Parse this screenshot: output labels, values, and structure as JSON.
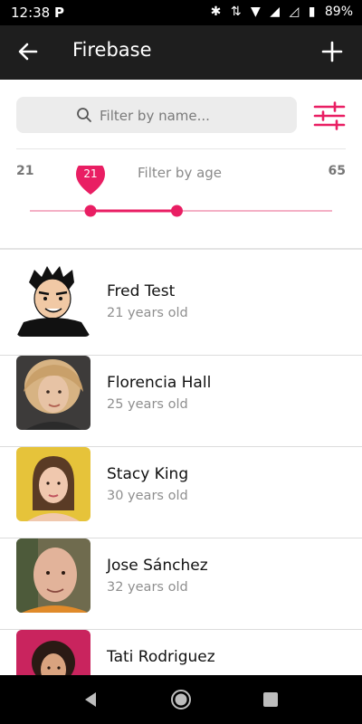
{
  "status_bar": {
    "time": "12:38",
    "battery": "89%"
  },
  "app_bar": {
    "title": "Firebase"
  },
  "search": {
    "placeholder": "Filter by name..."
  },
  "age_filter": {
    "label": "Filter by age",
    "min": "21",
    "max": "65",
    "bubble_value": "21",
    "range_low": 21,
    "range_high": 42
  },
  "colors": {
    "accent": "#e91e63",
    "appbar": "#1e1e1e"
  },
  "users": [
    {
      "name": "Fred Test",
      "age": "21 years old",
      "avatar": "cartoon-man-avatar"
    },
    {
      "name": "Florencia Hall",
      "age": "25 years old",
      "avatar": "woman-blonde-avatar"
    },
    {
      "name": "Stacy King",
      "age": "30 years old",
      "avatar": "woman-yellow-bg-avatar"
    },
    {
      "name": "Jose Sánchez",
      "age": "32 years old",
      "avatar": "bald-man-avatar"
    },
    {
      "name": "Tati Rodriguez",
      "age": "",
      "avatar": "woman-pink-bg-avatar"
    }
  ]
}
